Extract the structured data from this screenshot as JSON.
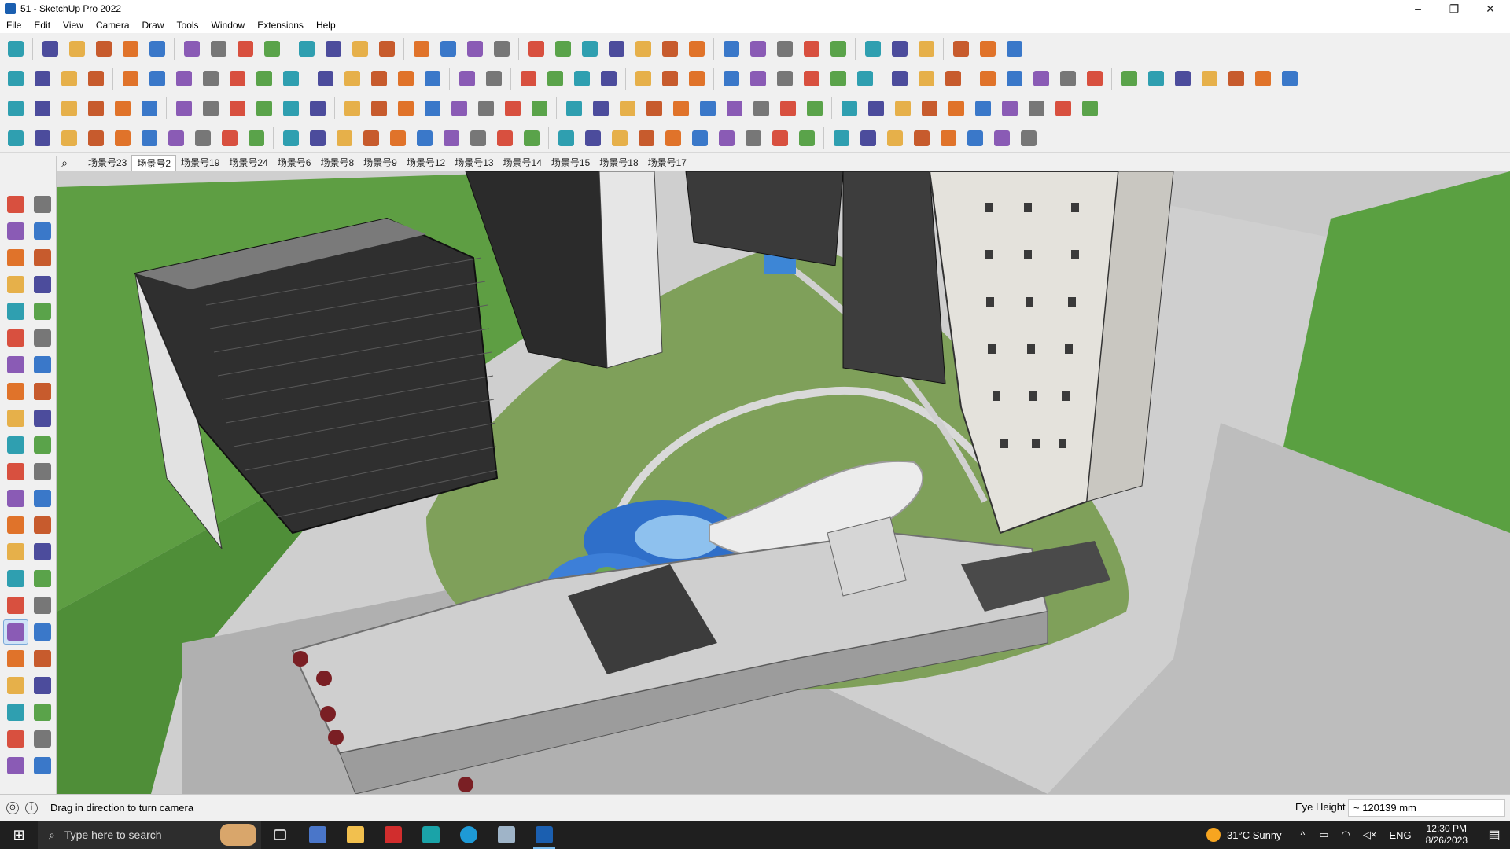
{
  "window": {
    "title": "51 - SketchUp Pro 2022",
    "minimize": "–",
    "maximize": "❐",
    "close": "✕"
  },
  "menu": [
    "File",
    "Edit",
    "View",
    "Camera",
    "Draw",
    "Tools",
    "Window",
    "Extensions",
    "Help"
  ],
  "scene_tabs": [
    "场景号23",
    "场景号2",
    "场景号19",
    "场景号24",
    "场景号6",
    "场景号8",
    "场景号9",
    "场景号12",
    "场景号13",
    "场景号14",
    "场景号15",
    "场景号18",
    "场景号17"
  ],
  "active_scene_index": 1,
  "status": {
    "message": "Drag in direction to turn camera",
    "measurement_label": "Eye Height",
    "measurement_value": "~ 120139 mm"
  },
  "taskbar": {
    "search_placeholder": "Type here to search",
    "apps": [
      "task-view",
      "calculator",
      "file-explorer",
      "acrobat",
      "3ds-max",
      "edge",
      "snipping-tool",
      "sketchup"
    ],
    "weather": "31°C  Sunny",
    "language": "ENG",
    "time": "12:30 PM",
    "date": "8/26/2023"
  },
  "colors": {
    "accent": "#1b5fb0",
    "lawn": "#7fa05a",
    "grass_field": "#5aa041",
    "pavement": "#a9a9a9",
    "building": "#e4e2dc",
    "water": "#2f6fc9"
  }
}
